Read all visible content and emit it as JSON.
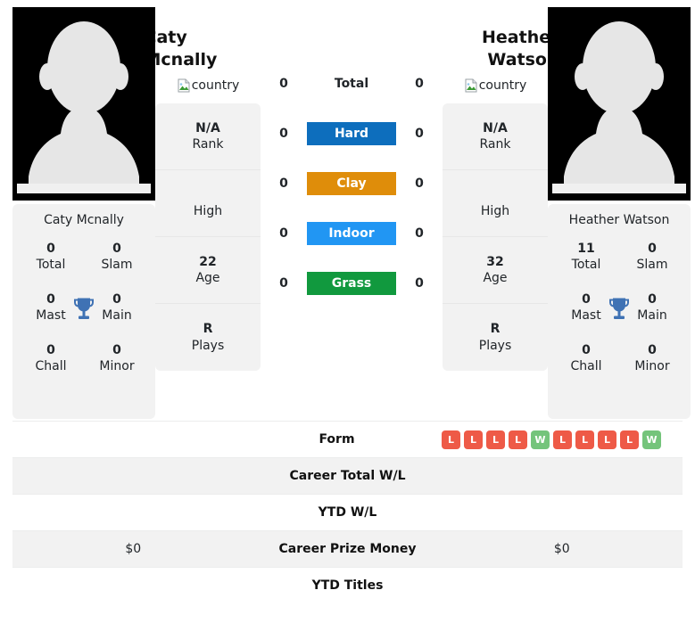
{
  "players": {
    "left": {
      "name": "Caty Mcnally",
      "photo_name": "player-silhouette",
      "flag_alt": "country",
      "card_name": "Caty Mcnally",
      "titles": [
        {
          "value": "0",
          "label": "Total"
        },
        {
          "value": "0",
          "label": "Slam"
        },
        {
          "value": "0",
          "label": "Mast"
        },
        {
          "value": "0",
          "label": "Main"
        },
        {
          "value": "0",
          "label": "Chall"
        },
        {
          "value": "0",
          "label": "Minor"
        }
      ],
      "info": [
        {
          "value": "N/A",
          "label": "Rank"
        },
        {
          "value": "",
          "label": "High"
        },
        {
          "value": "22",
          "label": "Age"
        },
        {
          "value": "R",
          "label": "Plays"
        }
      ]
    },
    "right": {
      "name": "Heather Watson",
      "photo_name": "player-silhouette",
      "flag_alt": "country",
      "card_name": "Heather Watson",
      "titles": [
        {
          "value": "11",
          "label": "Total"
        },
        {
          "value": "0",
          "label": "Slam"
        },
        {
          "value": "0",
          "label": "Mast"
        },
        {
          "value": "0",
          "label": "Main"
        },
        {
          "value": "0",
          "label": "Chall"
        },
        {
          "value": "0",
          "label": "Minor"
        }
      ],
      "info": [
        {
          "value": "N/A",
          "label": "Rank"
        },
        {
          "value": "",
          "label": "High"
        },
        {
          "value": "32",
          "label": "Age"
        },
        {
          "value": "R",
          "label": "Plays"
        }
      ]
    }
  },
  "surfaces": [
    {
      "label": "Total",
      "left": "0",
      "right": "0",
      "color": "transparent",
      "plain": true
    },
    {
      "label": "Hard",
      "left": "0",
      "right": "0",
      "color": "#0d6ebd",
      "plain": false
    },
    {
      "label": "Clay",
      "left": "0",
      "right": "0",
      "color": "#df8d0a",
      "plain": false
    },
    {
      "label": "Indoor",
      "left": "0",
      "right": "0",
      "color": "#2196f3",
      "plain": false
    },
    {
      "label": "Grass",
      "left": "0",
      "right": "0",
      "color": "#11993e",
      "plain": false
    }
  ],
  "table": {
    "rows": [
      {
        "label": "Form",
        "left": "",
        "right": "",
        "shade": false,
        "type": "form"
      },
      {
        "label": "Career Total W/L",
        "left": "",
        "right": "",
        "shade": true,
        "type": "text"
      },
      {
        "label": "YTD W/L",
        "left": "",
        "right": "",
        "shade": false,
        "type": "text"
      },
      {
        "label": "Career Prize Money",
        "left": "$0",
        "right": "$0",
        "shade": true,
        "type": "text"
      },
      {
        "label": "YTD Titles",
        "left": "",
        "right": "",
        "shade": false,
        "type": "text"
      }
    ],
    "form_badges": [
      "L",
      "L",
      "L",
      "L",
      "W",
      "L",
      "L",
      "L",
      "L",
      "W"
    ]
  },
  "colors": {
    "win": "#74c47b",
    "loss": "#ee5a47",
    "trophy": "#3f72b4",
    "card_bg": "#f2f2f2",
    "photo_bg": "#000000"
  }
}
